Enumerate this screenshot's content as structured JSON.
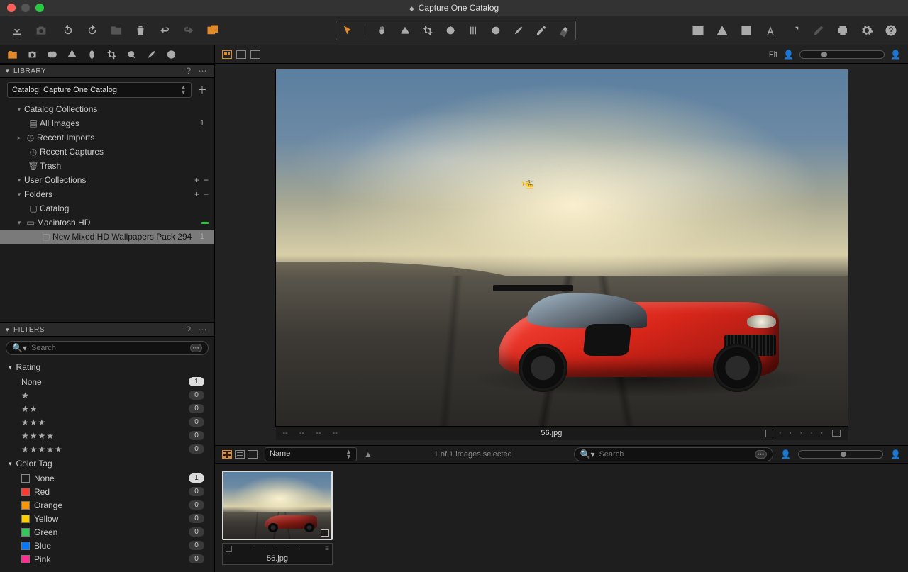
{
  "window": {
    "title": "Capture One Catalog"
  },
  "library": {
    "section": "LIBRARY",
    "catalog_selector": "Catalog: Capture One Catalog",
    "groups": {
      "catalog_collections": "Catalog Collections",
      "all_images": "All Images",
      "all_images_count": "1",
      "recent_imports": "Recent Imports",
      "recent_captures": "Recent Captures",
      "trash": "Trash",
      "user_collections": "User Collections",
      "folders": "Folders",
      "catalog_folder": "Catalog",
      "macintosh_hd": "Macintosh HD",
      "selected_folder": "New Mixed HD Wallpapers Pack 294",
      "selected_count": "1"
    }
  },
  "filters": {
    "section": "FILTERS",
    "search_placeholder": "Search",
    "rating_label": "Rating",
    "rating_none": "None",
    "star1": "★",
    "star2": "★★",
    "star3": "★★★",
    "star4": "★★★★",
    "star5": "★★★★★",
    "count_one": "1",
    "count_zero": "0",
    "colortag_label": "Color Tag",
    "tags": [
      {
        "name": "None",
        "color": "transparent"
      },
      {
        "name": "Red",
        "color": "#ff3b30"
      },
      {
        "name": "Orange",
        "color": "#ff9500"
      },
      {
        "name": "Yellow",
        "color": "#ffcc00"
      },
      {
        "name": "Green",
        "color": "#34c759"
      },
      {
        "name": "Blue",
        "color": "#007aff"
      },
      {
        "name": "Pink",
        "color": "#ff2d92"
      }
    ]
  },
  "viewer": {
    "fit_label": "Fit",
    "filename": "56.jpg",
    "dashes": "--",
    "sort_by": "Name",
    "status": "1 of 1 images selected",
    "search_placeholder": "Search"
  },
  "thumb": {
    "name": "56.jpg"
  }
}
